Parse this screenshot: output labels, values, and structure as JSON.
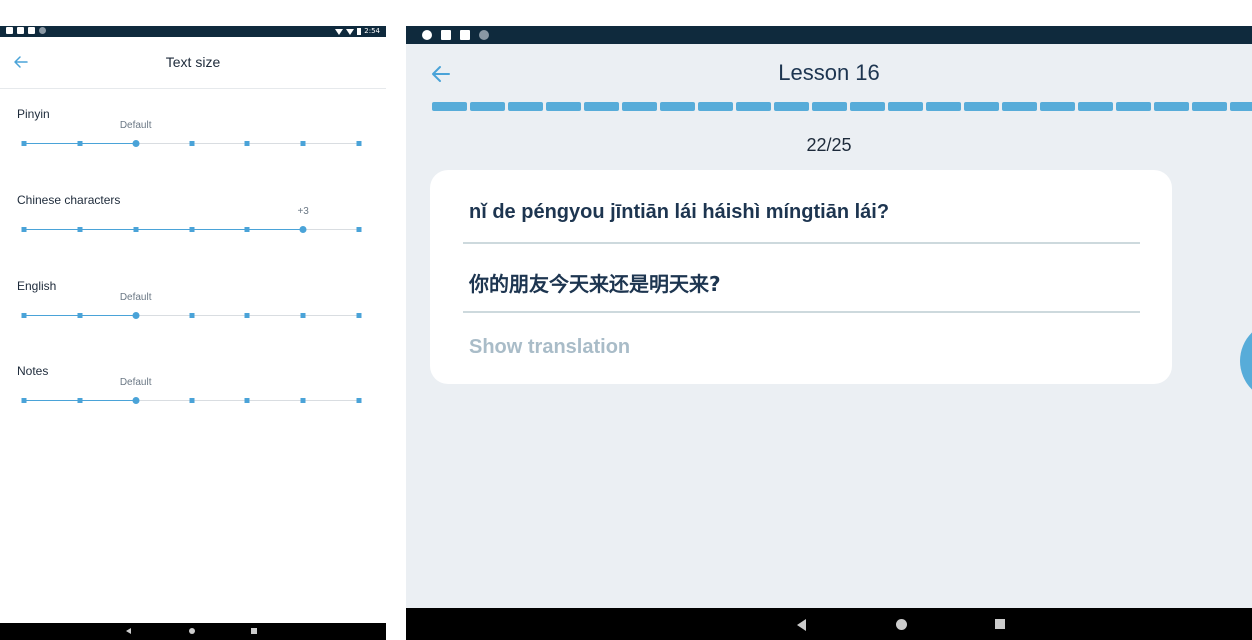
{
  "left": {
    "status": {
      "time": "2:54"
    },
    "header": {
      "title": "Text size",
      "back_icon": "arrow-left-icon"
    },
    "settings": [
      {
        "label": "Pinyin",
        "value": "Default",
        "level": 2,
        "steps": 7
      },
      {
        "label": "Chinese characters",
        "value": "+3",
        "level": 5,
        "steps": 7
      },
      {
        "label": "English",
        "value": "Default",
        "level": 2,
        "steps": 7
      },
      {
        "label": "Notes",
        "value": "Default",
        "level": 2,
        "steps": 7
      }
    ]
  },
  "right": {
    "header": {
      "title": "Lesson 16",
      "back_icon": "arrow-left-icon"
    },
    "progress": {
      "current": 22,
      "total": 25,
      "counter": "22/25"
    },
    "card": {
      "pinyin": "nǐ de péngyou jīntiān lái háishì míngtiān lái?",
      "hanzi": "你的朋友今天来还是明天来?",
      "show_translation": "Show translation"
    },
    "accent_color": "#57acd9"
  }
}
